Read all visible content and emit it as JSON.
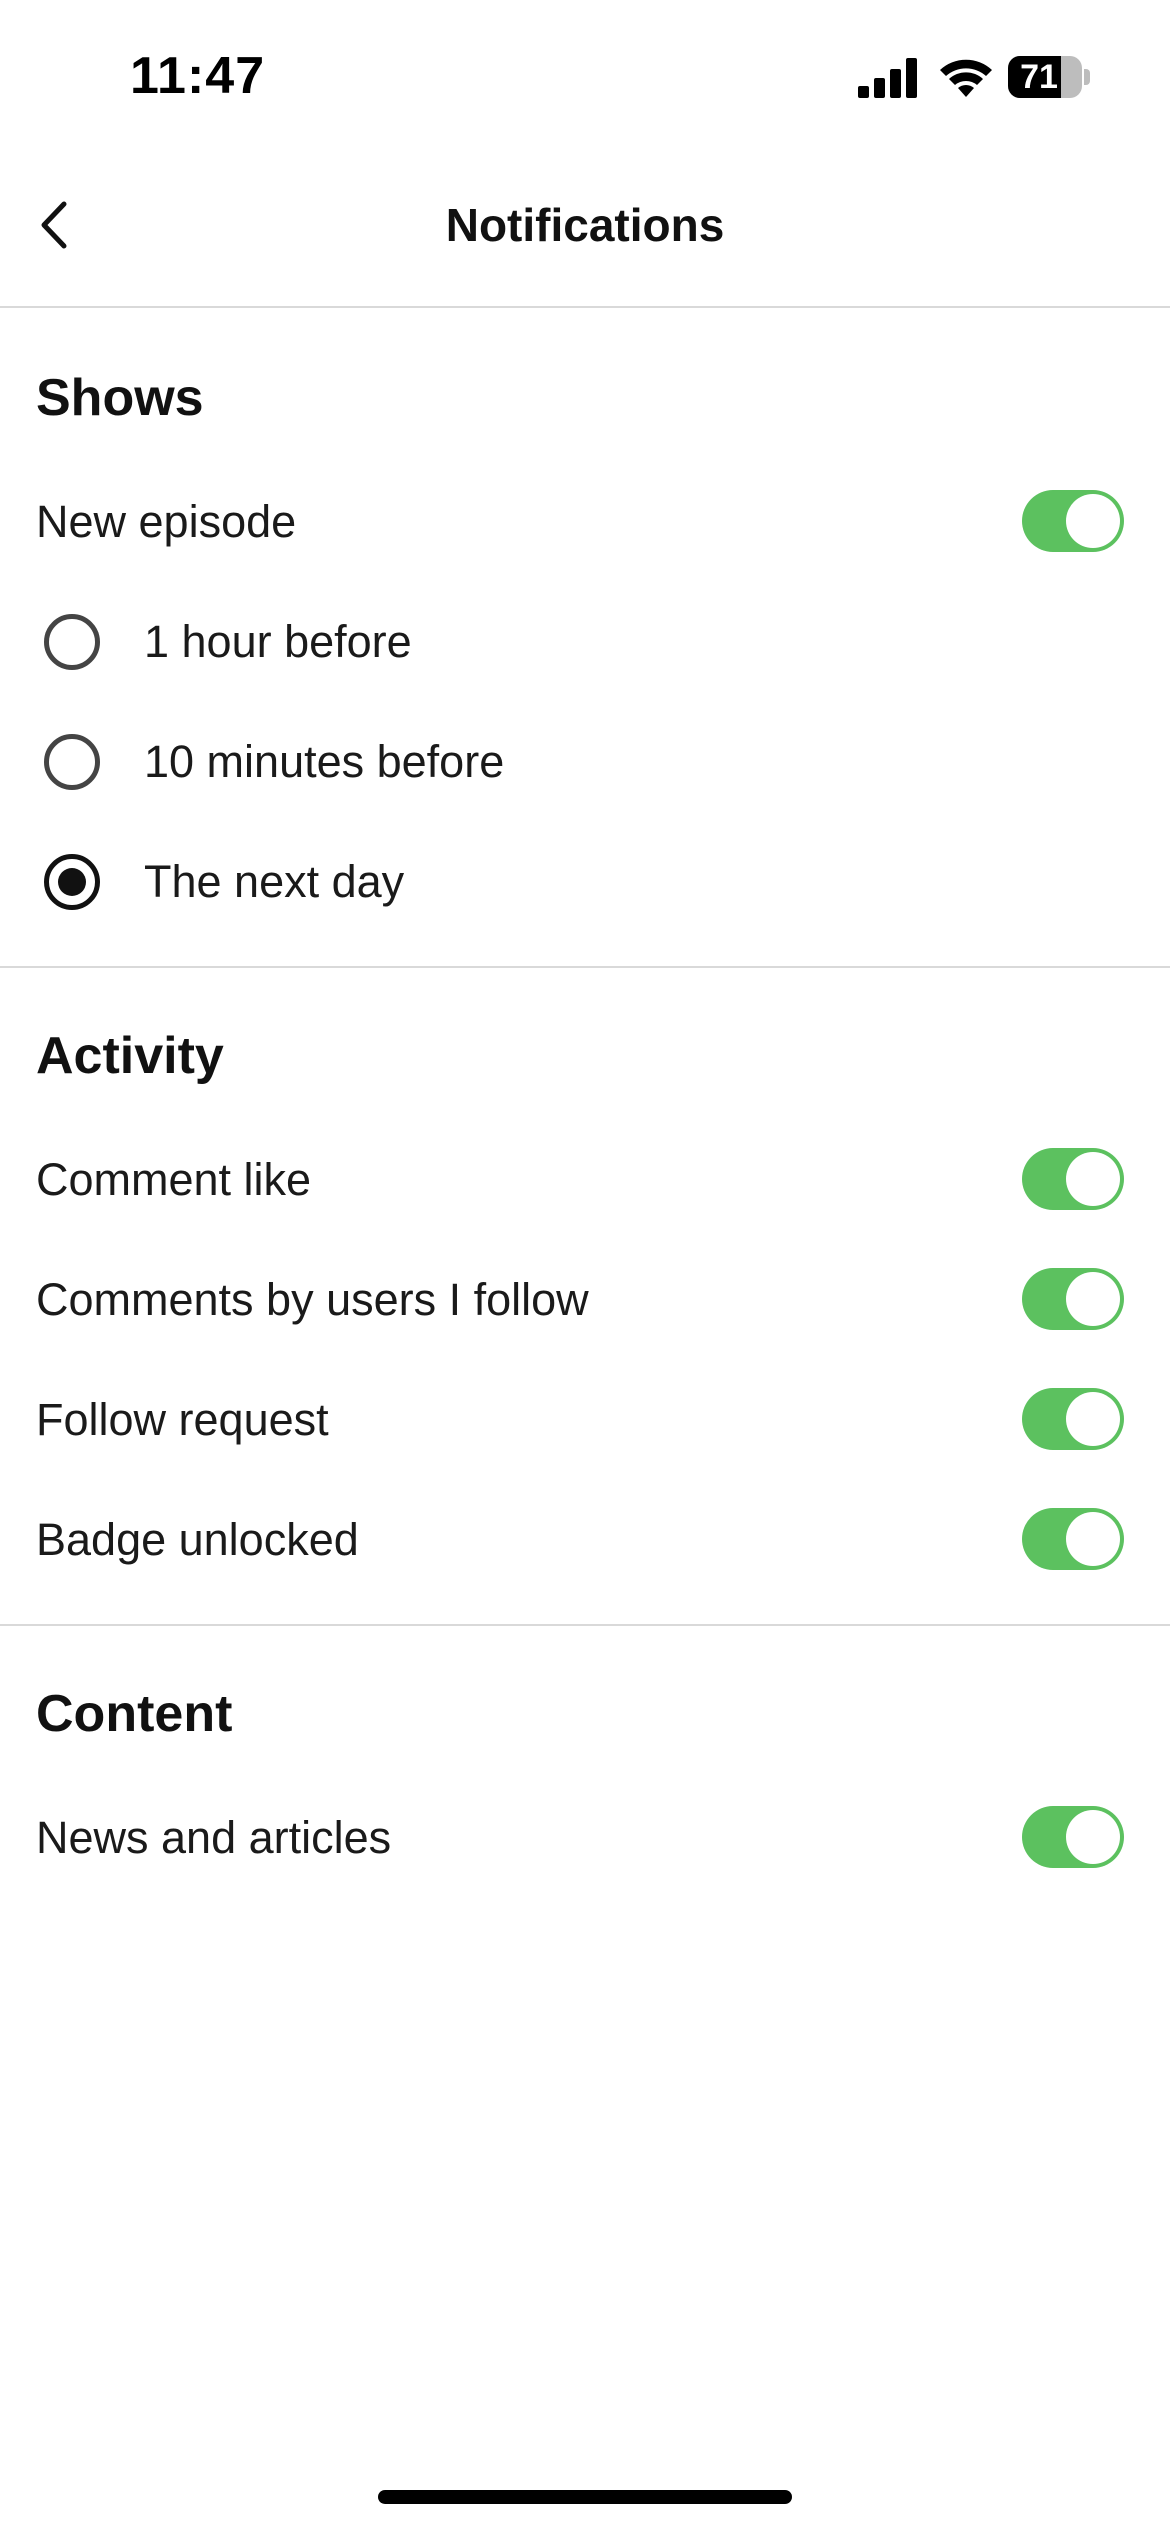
{
  "status_bar": {
    "time": "11:47",
    "battery": "71",
    "battery_level": 0.71,
    "icons": [
      "signal-icon",
      "wifi-icon",
      "battery-icon"
    ]
  },
  "nav": {
    "title": "Notifications",
    "back_icon": "chevron-left-icon"
  },
  "sections": {
    "shows": {
      "title": "Shows",
      "new_episode": {
        "label": "New episode",
        "enabled": true
      },
      "options": [
        {
          "label": "1 hour before",
          "selected": false
        },
        {
          "label": "10 minutes before",
          "selected": false
        },
        {
          "label": "The next day",
          "selected": true
        }
      ]
    },
    "activity": {
      "title": "Activity",
      "items": [
        {
          "label": "Comment like",
          "enabled": true
        },
        {
          "label": "Comments by users I follow",
          "enabled": true
        },
        {
          "label": "Follow request",
          "enabled": true
        },
        {
          "label": "Badge unlocked",
          "enabled": true
        }
      ]
    },
    "content": {
      "title": "Content",
      "items": [
        {
          "label": "News and articles",
          "enabled": true
        }
      ]
    }
  },
  "colors": {
    "toggle_on": "#5cc15f",
    "divider": "#d9d9d9",
    "text": "#111111"
  }
}
